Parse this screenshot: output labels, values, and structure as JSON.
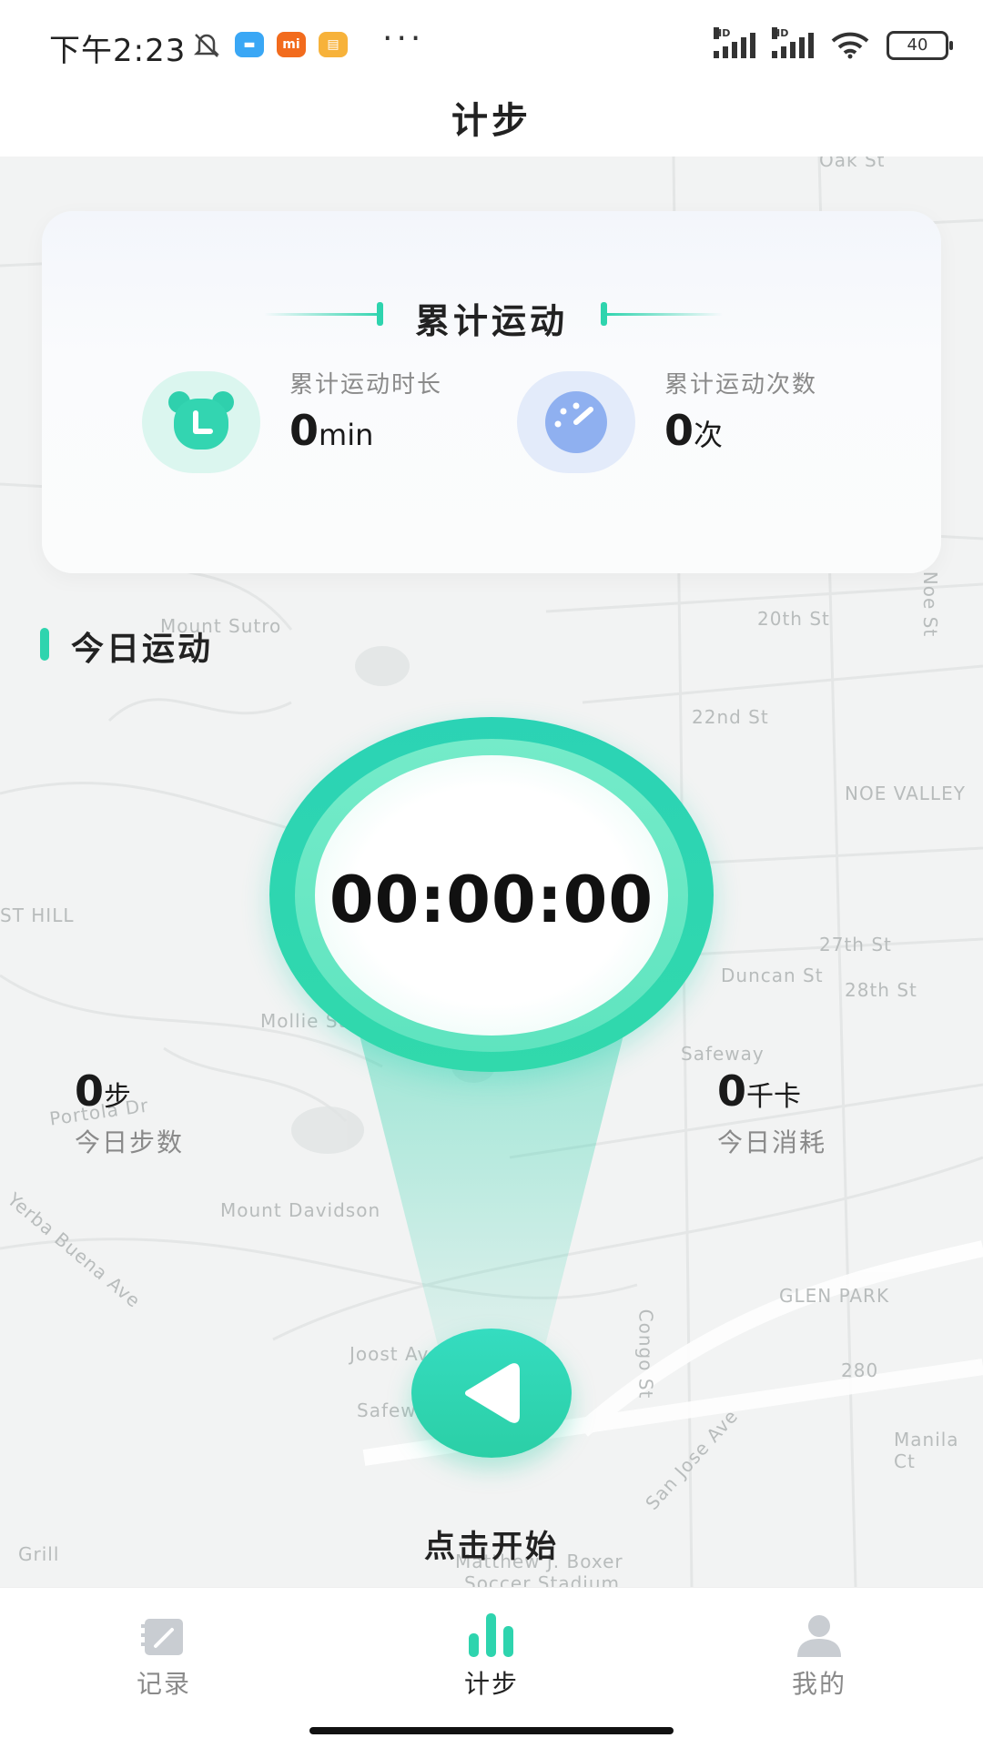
{
  "status_bar": {
    "time": "下午2:23",
    "battery": "40",
    "signal_tag": "HD",
    "more": "···",
    "app_badge": "mi"
  },
  "header": {
    "title": "计步"
  },
  "map_labels": [
    "Oak St",
    "20th St",
    "22nd St",
    "NOE VALLEY",
    "27th St",
    "Duncan St",
    "28th St",
    "Safeway",
    "Mollie St",
    "Portola Dr",
    "Mount Sutro",
    "Mount Davidson",
    "Yerba Buena Ave",
    "GLEN PARK",
    "Joost Ave",
    "Congo St",
    "Safeway",
    "San Jose Ave",
    "Manila Ct",
    "Matthew J. Boxer",
    "Soccer Stadium",
    "Noe St",
    "ST HILL",
    "Grill",
    "280"
  ],
  "summary_card": {
    "title": "累计运动",
    "duration": {
      "label": "累计运动时长",
      "value": "0",
      "unit": "min",
      "icon": "bear-clock-icon"
    },
    "count": {
      "label": "累计运动次数",
      "value": "0",
      "unit": "次",
      "icon": "speedometer-icon"
    }
  },
  "today": {
    "section_title": "今日运动",
    "timer": "00:00:00",
    "steps": {
      "value": "0",
      "unit": "步",
      "label": "今日步数"
    },
    "calories": {
      "value": "0",
      "unit": "千卡",
      "label": "今日消耗"
    },
    "start_label": "点击开始",
    "play_icon": "play-icon"
  },
  "bottom_nav": {
    "items": [
      {
        "label": "记录",
        "icon": "record-icon",
        "active": false
      },
      {
        "label": "计步",
        "icon": "bar-chart-icon",
        "active": true
      },
      {
        "label": "我的",
        "icon": "user-icon",
        "active": false
      }
    ]
  },
  "colors": {
    "accent": "#2ED4AE",
    "accent_dark": "#2BCFA6",
    "text": "#222222",
    "muted": "#8A8A8A",
    "count_icon": "#8FB0F0"
  }
}
